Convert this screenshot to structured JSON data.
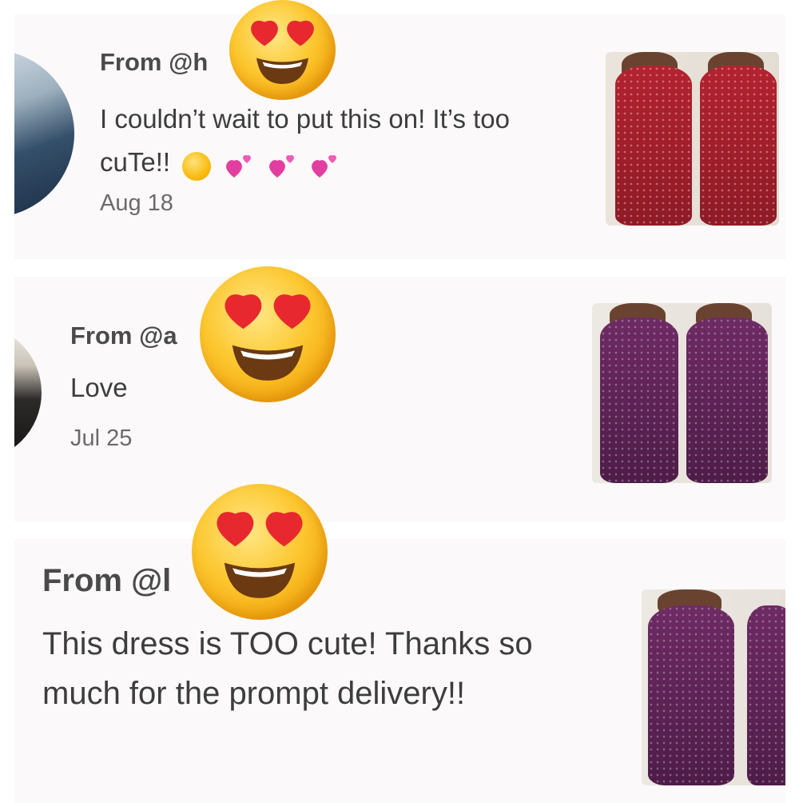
{
  "reviews": [
    {
      "from": "From @h",
      "message": "I couldn’t wait to put this on! It’s too cuTe!!",
      "date": "Aug 18",
      "photo_color": "#a81f2d"
    },
    {
      "from": "From @a",
      "message": "Love",
      "date": "Jul 25",
      "photo_color": "#5e2356"
    },
    {
      "from": "From @l",
      "message": "This dress is TOO cute! Thanks so much for the prompt delivery!!",
      "photo_color": "#5e2356"
    }
  ],
  "icons": {
    "overlay": "heart-eyes-emoji-icon",
    "inline": [
      "smiling-face-with-hearts-icon",
      "two-hearts-icon",
      "two-hearts-icon",
      "two-hearts-icon"
    ]
  },
  "colors": {
    "card_bg": "#fbf9fa",
    "text": "#3d3d3d",
    "heart_pink": "#e23ea0"
  }
}
